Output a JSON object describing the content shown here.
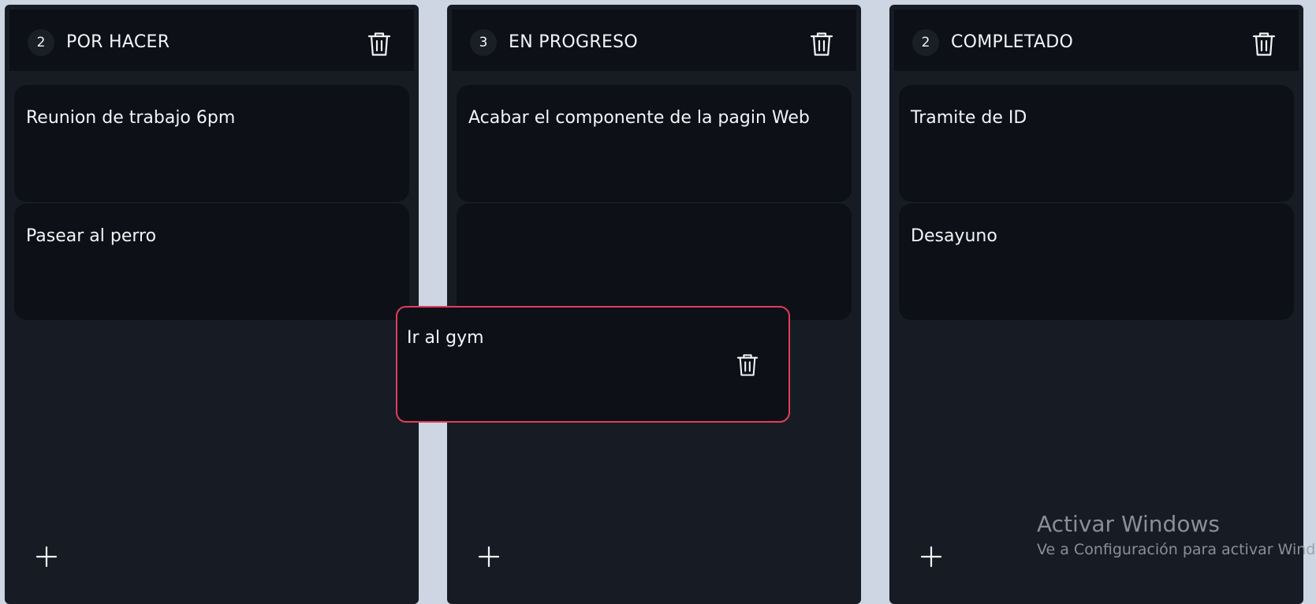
{
  "columns": [
    {
      "count": "2",
      "title": "POR HACER",
      "cards": [
        "Reunion de trabajo 6pm",
        "Pasear al perro"
      ]
    },
    {
      "count": "3",
      "title": "EN PROGRESO",
      "cards": [
        "Acabar el componente de la pagin Web",
        ""
      ]
    },
    {
      "count": "2",
      "title": "COMPLETADO",
      "cards": [
        "Tramite de ID",
        "Desayuno"
      ]
    }
  ],
  "dragging_card": {
    "text": "Ir al gym"
  },
  "icons": {
    "delete_column": "trash-icon",
    "delete_card": "trash-icon",
    "add_card": "plus-icon"
  },
  "colors": {
    "page_background": "#cdd6e2",
    "column_background": "#171c24",
    "header_background": "#0d1016",
    "card_background": "#0d1016",
    "drag_border": "#e23d5b",
    "text": "#f3f4f6"
  },
  "watermark": {
    "title": "Activar Windows",
    "subtitle": "Ve a Configuración para activar Windows."
  }
}
